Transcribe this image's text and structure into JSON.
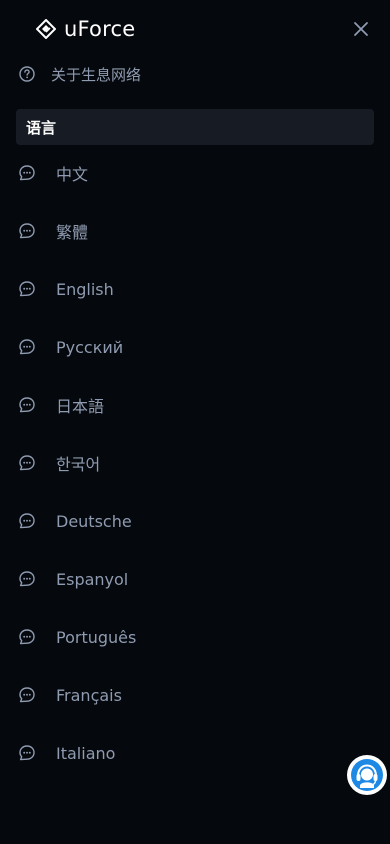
{
  "header": {
    "brand_name": "uForce",
    "close_icon": "close-icon"
  },
  "about": {
    "label": "关于生息网络",
    "icon": "help-circle-icon"
  },
  "language_section": {
    "title": "语言"
  },
  "languages": [
    {
      "label": "中文",
      "icon": "chat-bubble-icon"
    },
    {
      "label": "繁體",
      "icon": "chat-bubble-icon"
    },
    {
      "label": "English",
      "icon": "chat-bubble-icon"
    },
    {
      "label": "Русский",
      "icon": "chat-bubble-icon"
    },
    {
      "label": "日本語",
      "icon": "chat-bubble-icon"
    },
    {
      "label": "한국어",
      "icon": "chat-bubble-icon"
    },
    {
      "label": "Deutsche",
      "icon": "chat-bubble-icon"
    },
    {
      "label": "Espanyol",
      "icon": "chat-bubble-icon"
    },
    {
      "label": "Português",
      "icon": "chat-bubble-icon"
    },
    {
      "label": "Français",
      "icon": "chat-bubble-icon"
    },
    {
      "label": "Italiano",
      "icon": "chat-bubble-icon"
    }
  ],
  "support": {
    "icon": "customer-service-icon"
  },
  "colors": {
    "background": "#05080d",
    "text_muted": "#8f9bb0",
    "section_bg": "#161b24",
    "support_blue": "#1e88e5"
  }
}
